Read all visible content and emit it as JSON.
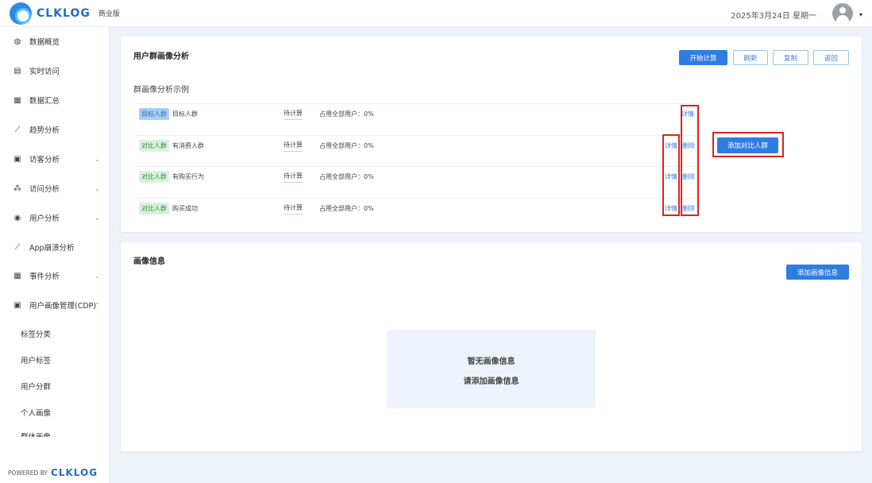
{
  "header": {
    "logo_text": "CLKLOG",
    "edition": "商业版",
    "date": "2025年3月24日 星期一",
    "caret": "▾"
  },
  "sidebar": {
    "items": [
      {
        "label": "数据概览",
        "icon": "dashboard-icon",
        "glyph": "◍",
        "chevron": ""
      },
      {
        "label": "实时访问",
        "icon": "realtime-icon",
        "glyph": "▤",
        "chevron": ""
      },
      {
        "label": "数据汇总",
        "icon": "summary-icon",
        "glyph": "▦",
        "chevron": ""
      },
      {
        "label": "趋势分析",
        "icon": "trend-icon",
        "glyph": "⟋",
        "chevron": ""
      },
      {
        "label": "访客分析",
        "icon": "visitor-icon",
        "glyph": "▣",
        "chevron": "⌄"
      },
      {
        "label": "访问分析",
        "icon": "access-icon",
        "glyph": "⁂",
        "chevron": "⌄"
      },
      {
        "label": "用户分析",
        "icon": "user-icon",
        "glyph": "◉",
        "chevron": "⌄"
      },
      {
        "label": "App崩溃分析",
        "icon": "crash-icon",
        "glyph": "⟋",
        "chevron": ""
      },
      {
        "label": "事件分析",
        "icon": "event-icon",
        "glyph": "▦",
        "chevron": "⌄"
      },
      {
        "label": "用户画像管理(CDP)",
        "icon": "cdp-icon",
        "glyph": "▣",
        "chevron": "⌃"
      }
    ],
    "sub_items": [
      "标签分类",
      "用户标签",
      "用户分群",
      "个人画像",
      "群体画像"
    ],
    "powered_by": "POWERED BY",
    "powered_logo": "CLKLOG"
  },
  "top_card": {
    "title": "用户群画像分析",
    "buttons": {
      "start": "开始计算",
      "refresh": "刷新",
      "copy": "复制",
      "back": "返回"
    },
    "subtitle": "群画像分析示例",
    "add_compare": "添加对比人群",
    "rows": [
      {
        "tag": "目标人群",
        "tag_type": "target",
        "name": "目标人群",
        "status": "待计算",
        "ratio": "占用全部用户：0%",
        "detail": "详情",
        "delete": ""
      },
      {
        "tag": "对比人群",
        "tag_type": "compare",
        "name": "有消费人群",
        "status": "待计算",
        "ratio": "占用全部用户：0%",
        "detail": "详情",
        "delete": "删除"
      },
      {
        "tag": "对比人群",
        "tag_type": "compare",
        "name": "有购买行为",
        "status": "待计算",
        "ratio": "占用全部用户：0%",
        "detail": "详情",
        "delete": "删除"
      },
      {
        "tag": "对比人群",
        "tag_type": "compare",
        "name": "购买成功",
        "status": "待计算",
        "ratio": "占用全部用户：0%",
        "detail": "详情",
        "delete": "删除"
      }
    ]
  },
  "bottom_card": {
    "title": "画像信息",
    "add_button": "添加画像信息",
    "empty_line1": "暂无画像信息",
    "empty_line2": "请添加画像信息"
  },
  "colors": {
    "primary": "#2f7de1",
    "highlight": "#e02020",
    "page_bg": "#eef2f9"
  }
}
